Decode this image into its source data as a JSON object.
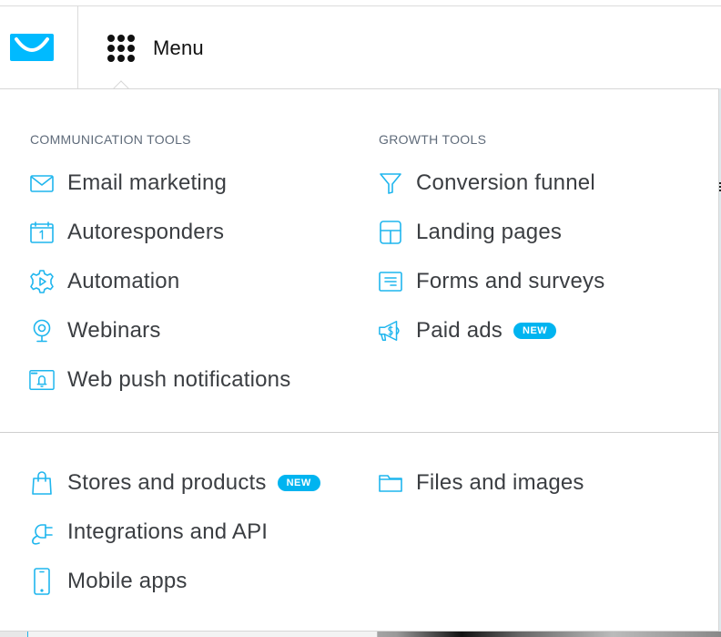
{
  "header": {
    "logo_alt": "GetResponse logo",
    "menu_label": "Menu",
    "menu_icon": "grid-dots-icon"
  },
  "colors": {
    "accent": "#00baff",
    "icon": "#1fb6ee",
    "badge": "#00b4f0",
    "text": "#3b3e42",
    "section_title": "#5f6b7a"
  },
  "sections": {
    "communication": {
      "title": "COMMUNICATION TOOLS",
      "items": [
        {
          "label": "Email marketing",
          "icon": "envelope-icon"
        },
        {
          "label": "Autoresponders",
          "icon": "calendar-icon"
        },
        {
          "label": "Automation",
          "icon": "gear-play-icon"
        },
        {
          "label": "Webinars",
          "icon": "webcam-icon"
        },
        {
          "label": "Web push notifications",
          "icon": "browser-bell-icon"
        }
      ]
    },
    "growth": {
      "title": "GROWTH TOOLS",
      "items": [
        {
          "label": "Conversion funnel",
          "icon": "funnel-icon"
        },
        {
          "label": "Landing pages",
          "icon": "layout-icon"
        },
        {
          "label": "Forms and surveys",
          "icon": "form-icon"
        },
        {
          "label": "Paid ads",
          "icon": "megaphone-dollar-icon",
          "badge": "NEW"
        }
      ]
    },
    "other_left": {
      "items": [
        {
          "label": "Stores and products",
          "icon": "shopping-bag-icon",
          "badge": "NEW"
        },
        {
          "label": "Integrations and API",
          "icon": "plug-icon"
        },
        {
          "label": "Mobile apps",
          "icon": "smartphone-icon"
        }
      ]
    },
    "other_right": {
      "items": [
        {
          "label": "Files and images",
          "icon": "folder-icon"
        }
      ]
    }
  }
}
